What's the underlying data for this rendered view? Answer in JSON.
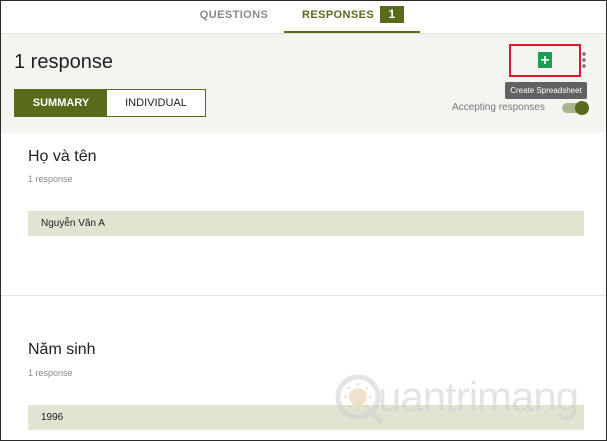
{
  "tabs": {
    "questions_label": "QUESTIONS",
    "responses_label": "RESPONSES",
    "responses_count": "1"
  },
  "header": {
    "title": "1 response",
    "summary_label": "SUMMARY",
    "individual_label": "INDIVIDUAL",
    "create_spreadsheet_icon": "spreadsheet-plus-icon",
    "tooltip": "Create Spreadsheet",
    "more_icon": "more-vert-icon",
    "accepting_label": "Accepting responses",
    "accepting_on": true
  },
  "questions": [
    {
      "title": "Họ và tên",
      "count": "1 response",
      "answers": [
        "Nguyễn Văn A"
      ]
    },
    {
      "title": "Năm sinh",
      "count": "1 response",
      "answers": [
        "1996"
      ]
    }
  ],
  "colors": {
    "accent": "#586b1b",
    "answer_bg": "#e0e4d0",
    "highlight_box": "#e0172f",
    "sheets_green": "#1b9e4f"
  },
  "watermark": {
    "text": "uantrimang",
    "logo": "quantrimang-logo"
  }
}
